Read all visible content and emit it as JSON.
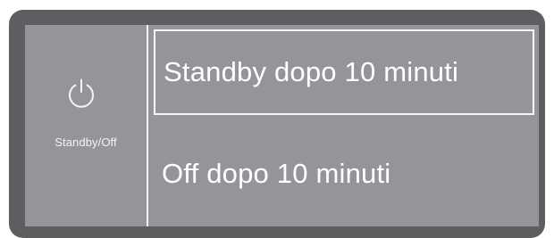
{
  "mode": {
    "label": "Standby/Off",
    "icon": "power-icon"
  },
  "options": [
    {
      "label": "Standby dopo 10 minuti",
      "selected": true
    },
    {
      "label": "Off dopo 10 minuti",
      "selected": false
    }
  ],
  "colors": {
    "bezel": "#5d5e60",
    "screen": "#939598",
    "text": "#ffffff"
  }
}
